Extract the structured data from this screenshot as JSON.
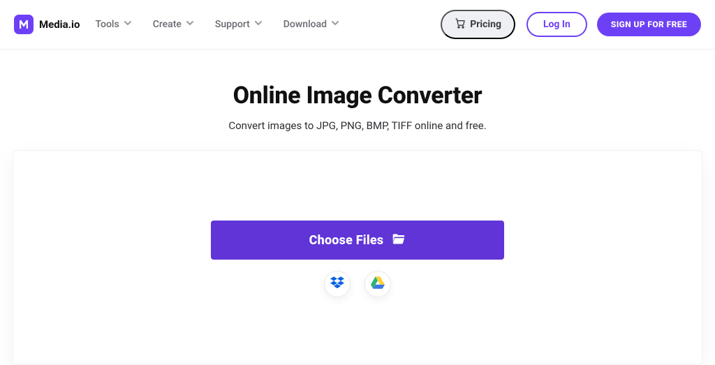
{
  "brand": "Media.io",
  "nav": {
    "items": [
      {
        "label": "Tools"
      },
      {
        "label": "Create"
      },
      {
        "label": "Support"
      },
      {
        "label": "Download"
      }
    ]
  },
  "header": {
    "pricing": "Pricing",
    "login": "Log In",
    "signup": "SIGN UP FOR FREE"
  },
  "hero": {
    "title": "Online Image Converter",
    "subtitle": "Convert images to JPG, PNG, BMP, TIFF online and free."
  },
  "uploader": {
    "choose": "Choose Files"
  },
  "colors": {
    "accent": "#6e40f5",
    "accent_dark": "#6034d6",
    "muted_bg": "#eef0f4"
  }
}
